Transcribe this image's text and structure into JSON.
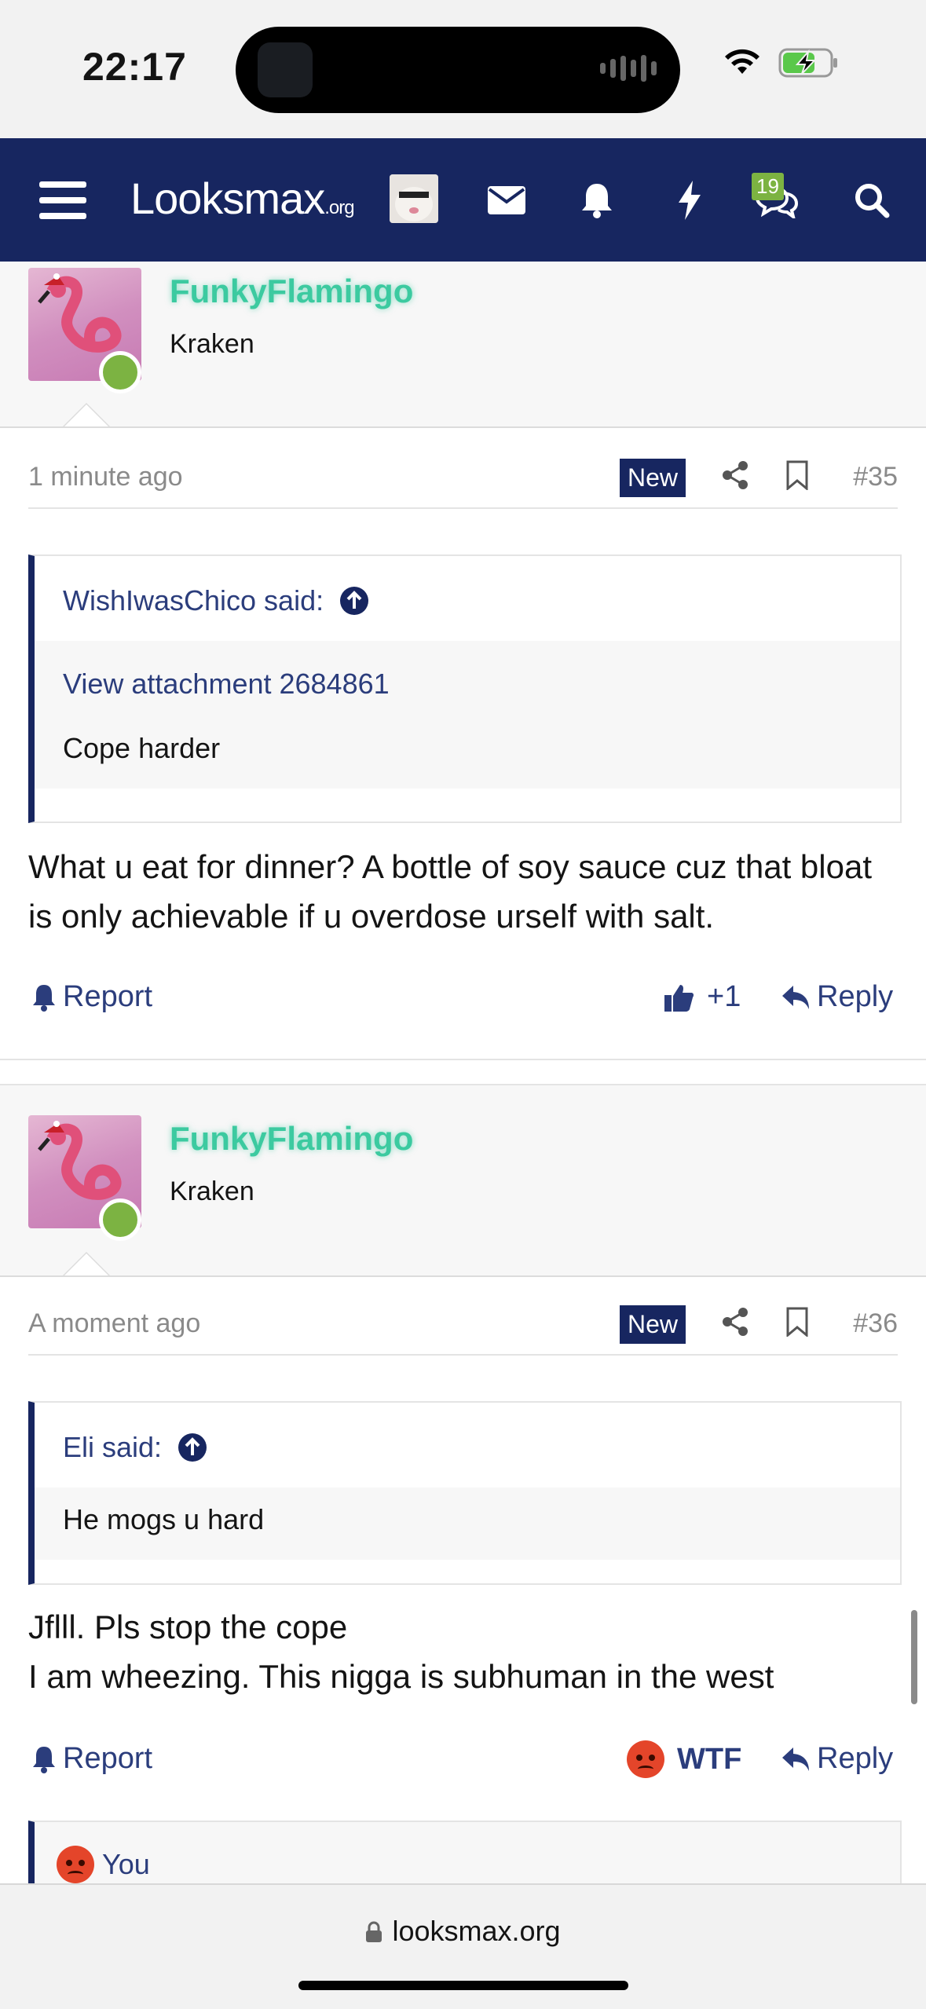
{
  "status": {
    "time": "22:17"
  },
  "nav": {
    "logo_main": "Looksmax",
    "logo_tld": ".org",
    "conversations_badge": "19"
  },
  "posts": [
    {
      "username": "FunkyFlamingo",
      "user_title": "Kraken",
      "date": "1 minute ago",
      "new_label": "New",
      "number": "#35",
      "quote_author": "WishIwasChico said:",
      "quote_link": "View attachment 2684861",
      "quote_text": "Cope harder",
      "message": "What u eat for dinner? A bottle of soy sauce cuz that bloat is only achievable if u overdose urself with salt.",
      "report_label": "Report",
      "reaction_label": "+1",
      "reply_label": "Reply"
    },
    {
      "username": "FunkyFlamingo",
      "user_title": "Kraken",
      "date": "A moment ago",
      "new_label": "New",
      "number": "#36",
      "quote_author": "Eli said:",
      "quote_text": "He mogs u hard",
      "message_line1": "Jflll. Pls stop the cope",
      "message_line2": "I am wheezing. This nigga is subhuman in the west",
      "report_label": "Report",
      "reaction_label": "WTF",
      "reply_label": "Reply",
      "reactions_summary": "You"
    }
  ],
  "browser": {
    "url": "looksmax.org"
  },
  "colors": {
    "nav_bg": "#172660",
    "link": "#2b3d7c",
    "username": "#3ccaa0",
    "online": "#7cb342"
  }
}
